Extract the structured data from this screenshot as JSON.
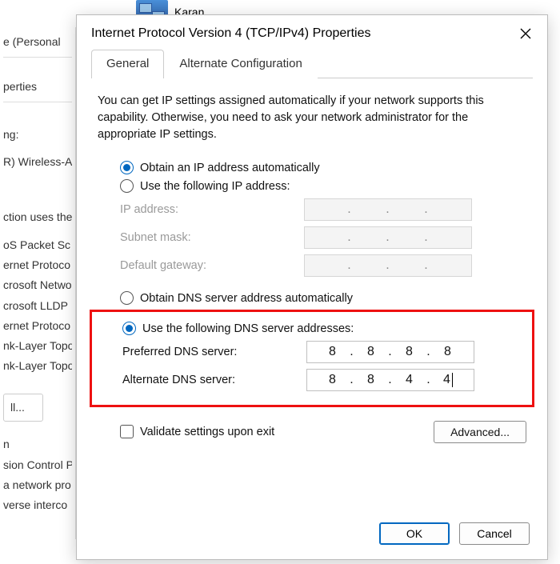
{
  "bg": {
    "user": "Karan",
    "tab_personal": "e (Personal",
    "left": {
      "properties": "perties",
      "using": "ng:",
      "adapter": "R) Wireless-A",
      "uses": "ction uses the",
      "items": [
        "oS Packet Sc",
        "ernet Protoco",
        "crosoft Netwo",
        "crosoft LLDP",
        "ernet Protoco",
        "nk-Layer Topo",
        "nk-Layer Topo"
      ],
      "install": "ll...",
      "desc_head": "n",
      "desc1": "sion Control P",
      "desc2": "a network pro",
      "desc3": "verse interco"
    }
  },
  "dialog": {
    "title": "Internet Protocol Version 4 (TCP/IPv4) Properties",
    "tabs": {
      "general": "General",
      "alt": "Alternate Configuration"
    },
    "desc": "You can get IP settings assigned automatically if your network supports this capability. Otherwise, you need to ask your network administrator for the appropriate IP settings.",
    "ip": {
      "auto": "Obtain an IP address automatically",
      "manual": "Use the following IP address:",
      "addr": "IP address:",
      "mask": "Subnet mask:",
      "gateway": "Default gateway:"
    },
    "dns": {
      "auto": "Obtain DNS server address automatically",
      "manual": "Use the following DNS server addresses:",
      "preferred": "Preferred DNS server:",
      "alternate": "Alternate DNS server:",
      "pref_val": [
        "8",
        "8",
        "8",
        "8"
      ],
      "alt_val": [
        "8",
        "8",
        "4",
        "4"
      ]
    },
    "validate": "Validate settings upon exit",
    "advanced": "Advanced...",
    "ok": "OK",
    "cancel": "Cancel"
  }
}
